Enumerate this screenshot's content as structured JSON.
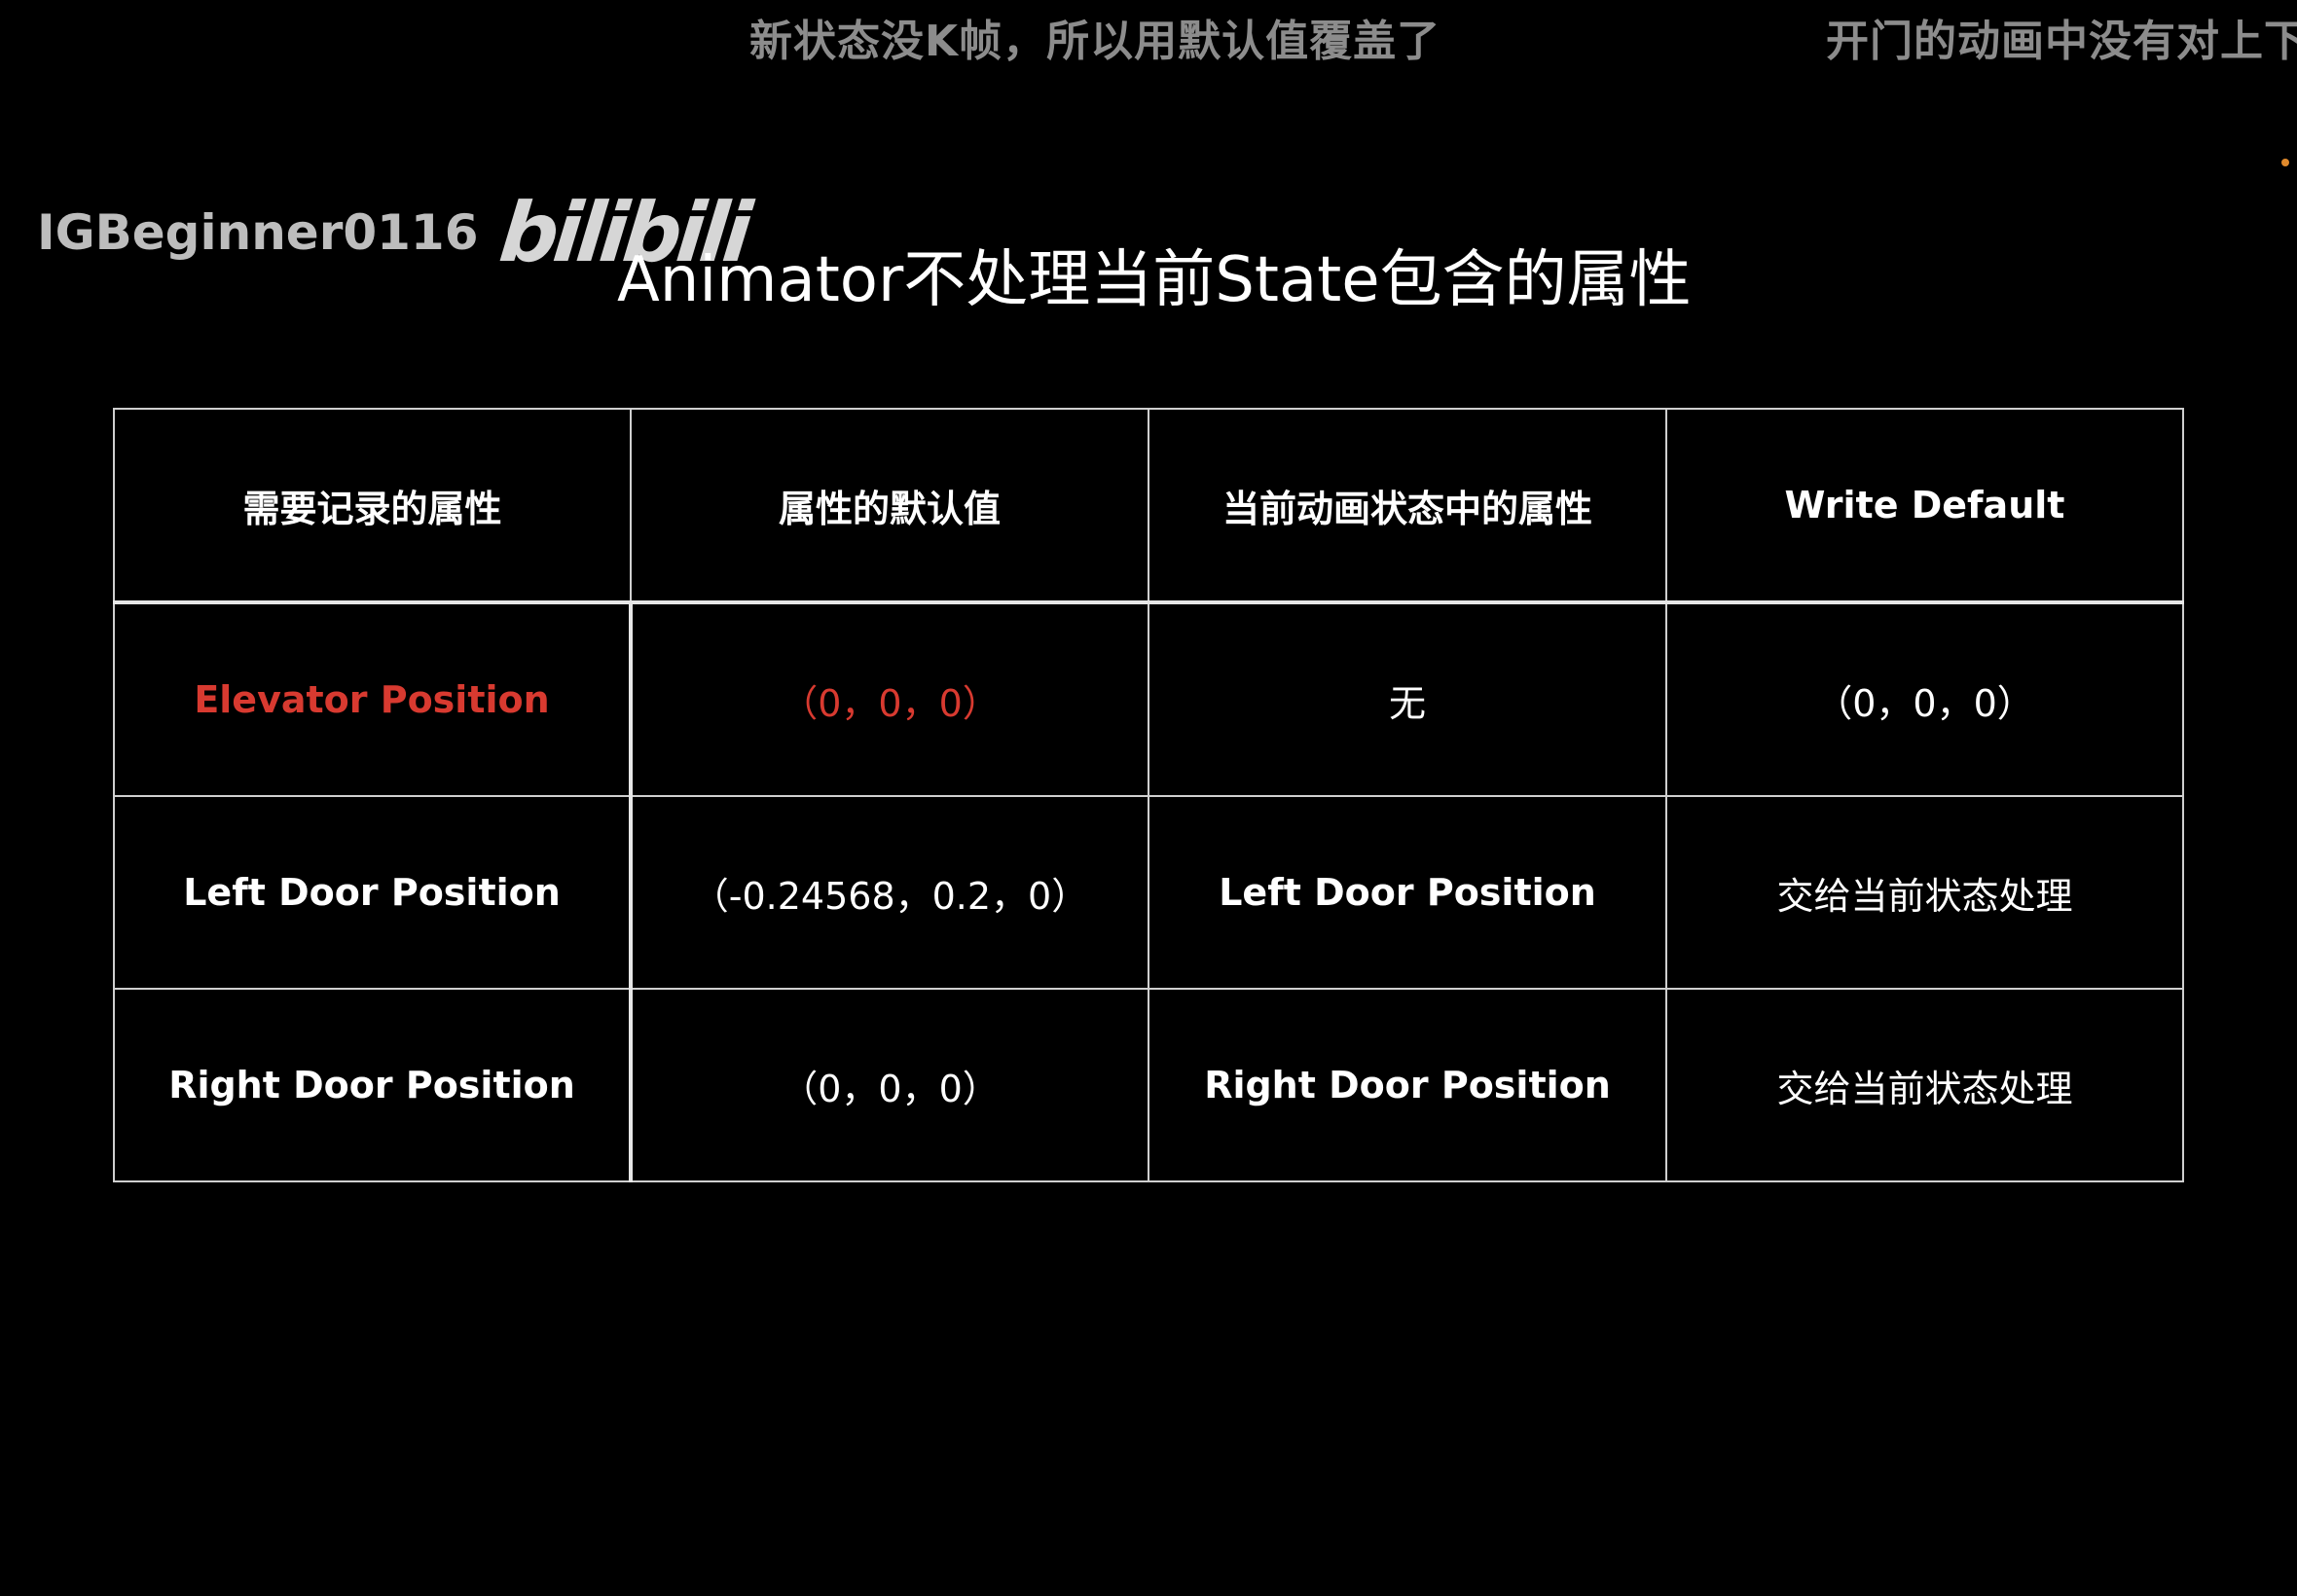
{
  "overlay": {
    "danmaku": [
      "新状态没K帧，所以用默认值覆盖了",
      "开门的动画中没有对上下"
    ],
    "watermark_user": "IGBeginner0116",
    "watermark_logo": "bilibili"
  },
  "slide": {
    "title": "Animator不处理当前State包含的属性",
    "table": {
      "headers": [
        "需要记录的属性",
        "属性的默认值",
        "当前动画状态中的属性",
        "Write Default"
      ],
      "rows": [
        {
          "property": "Elevator Position",
          "default_value": "（0，0，0）",
          "current_state_property": "无",
          "write_default": "（0，0，0）"
        },
        {
          "property": "Left Door Position",
          "default_value": "（-0.24568，0.2，0）",
          "current_state_property": "Left Door Position",
          "write_default": "交给当前状态处理"
        },
        {
          "property": "Right Door Position",
          "default_value": "（0，0，0）",
          "current_state_property": "Right Door Position",
          "write_default": "交给当前状态处理"
        }
      ]
    }
  },
  "colors": {
    "background": "#000000",
    "highlight_red": "#d83a30",
    "danmaku_gray": "#8c8c8c",
    "accent_orange": "#e08a2c"
  }
}
